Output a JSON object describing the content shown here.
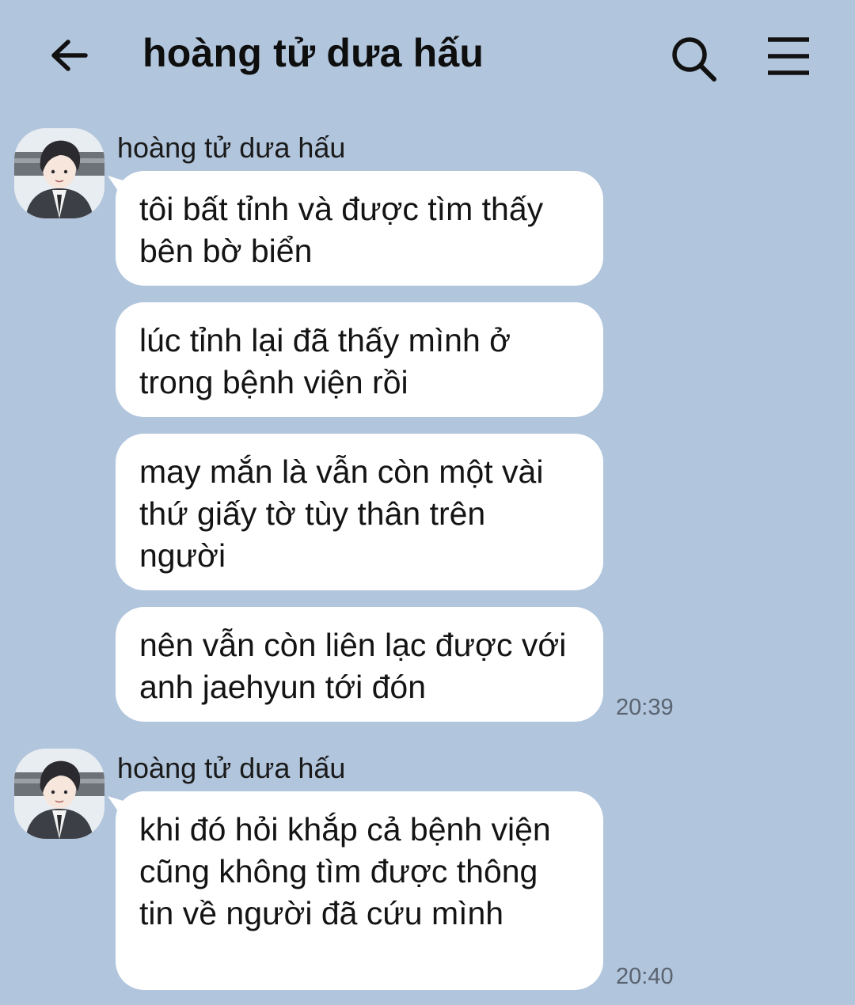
{
  "header": {
    "title": "hoàng tử dưa hấu",
    "back_icon": "arrow-left-icon",
    "search_icon": "search-icon",
    "menu_icon": "hamburger-menu-icon"
  },
  "colors": {
    "background": "#b1c5dc",
    "bubble": "#ffffff",
    "timestamp": "#5a6370"
  },
  "groups": [
    {
      "sender": "hoàng tử dưa hấu",
      "messages": [
        "tôi bất tỉnh và được tìm thấy bên bờ biển",
        "lúc tỉnh lại đã thấy mình ở trong bệnh viện rồi",
        "may mắn là vẫn còn một vài thứ giấy tờ tùy thân trên người",
        "nên vẫn còn liên lạc được với anh jaehyun tới đón"
      ],
      "time": "20:39"
    },
    {
      "sender": "hoàng tử dưa hấu",
      "messages": [
        "khi đó hỏi khắp cả bệnh viện cũng không tìm được thông tin về người đã cứu mình"
      ],
      "time": "20:40"
    }
  ]
}
